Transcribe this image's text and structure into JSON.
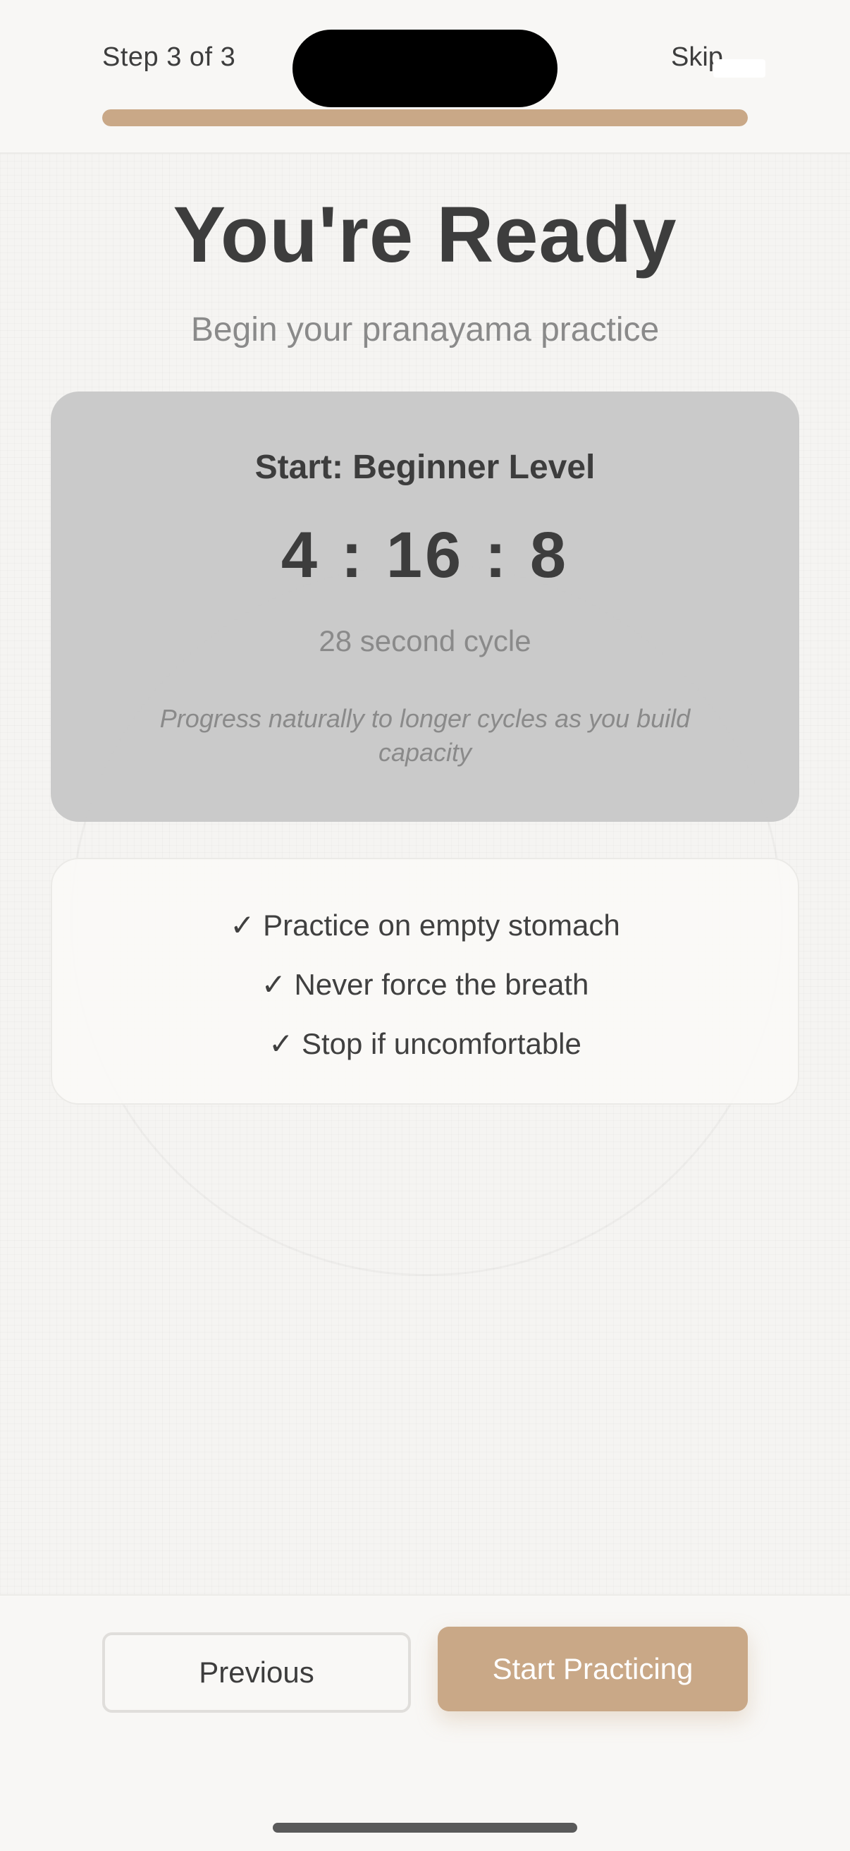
{
  "header": {
    "step_label": "Step 3 of 3",
    "skip_label": "Skip",
    "progress_fraction": 1.0,
    "accent_color": "#c9a887"
  },
  "main": {
    "title": "You're Ready",
    "subtitle": "Begin your pranayama practice",
    "level_card": {
      "title": "Start: Beginner Level",
      "ratio": "4 : 16 : 8",
      "cycle": "28 second cycle",
      "note": "Progress naturally to longer cycles as you build capacity"
    },
    "tips": [
      "✓ Practice on empty stomach",
      "✓ Never force the breath",
      "✓ Stop if uncomfortable"
    ]
  },
  "footer": {
    "previous_label": "Previous",
    "start_label": "Start Practicing"
  }
}
